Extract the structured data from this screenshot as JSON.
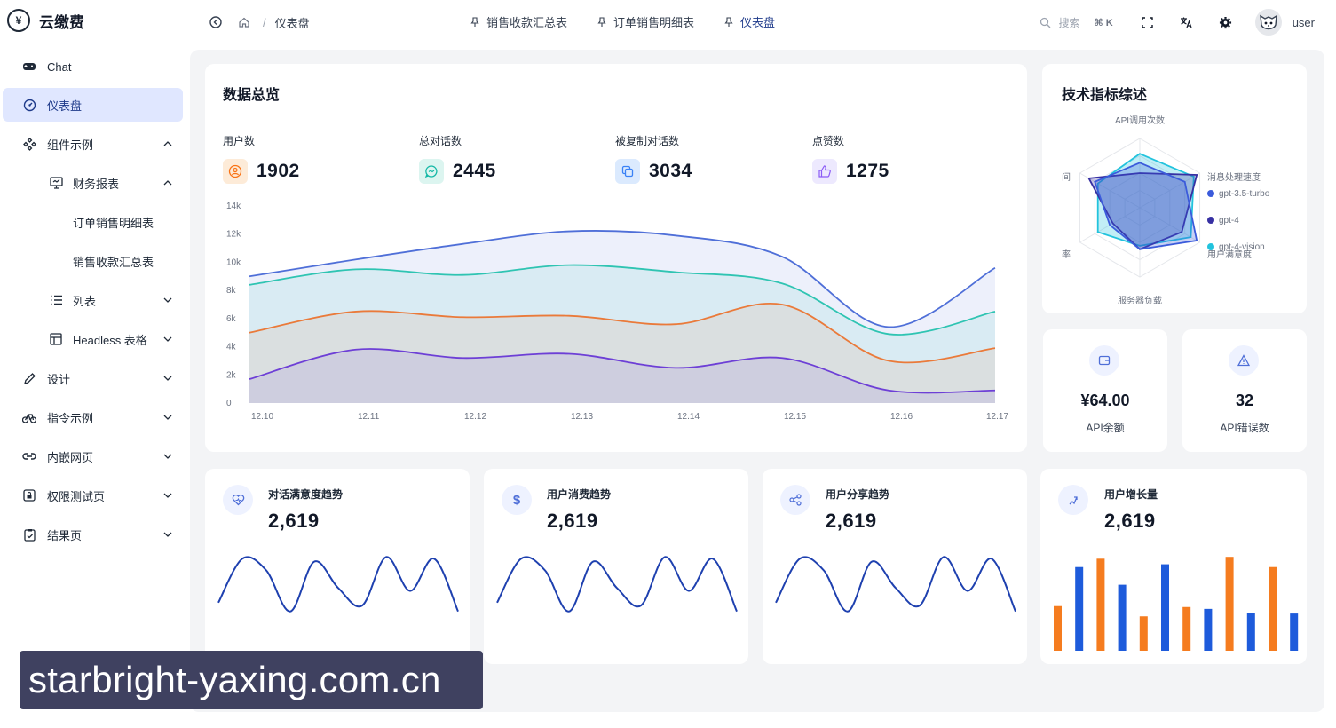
{
  "brand": {
    "name": "云缴费"
  },
  "breadcrumb": {
    "current": "仪表盘",
    "separator": "/"
  },
  "tabs": [
    {
      "label": "销售收款汇总表",
      "active": false
    },
    {
      "label": "订单销售明细表",
      "active": false
    },
    {
      "label": "仪表盘",
      "active": true
    }
  ],
  "header": {
    "search_placeholder": "搜索",
    "search_shortcut": "⌘ K",
    "username": "user"
  },
  "sidebar": {
    "items": [
      {
        "label": "Chat"
      },
      {
        "label": "仪表盘"
      },
      {
        "label": "组件示例"
      },
      {
        "label": "财务报表"
      },
      {
        "label": "订单销售明细表"
      },
      {
        "label": "销售收款汇总表"
      },
      {
        "label": "列表"
      },
      {
        "label": "Headless 表格"
      },
      {
        "label": "设计"
      },
      {
        "label": "指令示例"
      },
      {
        "label": "内嵌网页"
      },
      {
        "label": "权限测试页"
      },
      {
        "label": "结果页"
      }
    ]
  },
  "overview": {
    "title": "数据总览",
    "stats": [
      {
        "label": "用户数",
        "value": "1902",
        "color": "#f97316"
      },
      {
        "label": "总对话数",
        "value": "2445",
        "color": "#14b8a6"
      },
      {
        "label": "被复制对话数",
        "value": "3034",
        "color": "#3b82f6"
      },
      {
        "label": "点赞数",
        "value": "1275",
        "color": "#8b5cf6"
      }
    ]
  },
  "chart_data": [
    {
      "type": "area",
      "x": [
        "12.10",
        "12.11",
        "12.12",
        "12.13",
        "12.14",
        "12.15",
        "12.16",
        "12.17"
      ],
      "ylim": [
        0,
        14000
      ],
      "yticks": [
        "0",
        "2k",
        "4k",
        "6k",
        "8k",
        "10k",
        "12k",
        "14k"
      ],
      "series": [
        {
          "color": "#4f6fd8",
          "values": [
            9000,
            10200,
            11300,
            12200,
            11900,
            10400,
            5400,
            9600
          ]
        },
        {
          "color": "#2fc4b2",
          "values": [
            8400,
            9500,
            9100,
            9800,
            9300,
            8500,
            4900,
            6500
          ]
        },
        {
          "color": "#ea7a3a",
          "values": [
            5000,
            6500,
            6100,
            6200,
            5600,
            7000,
            3000,
            3900
          ]
        },
        {
          "color": "#6d3fd6",
          "values": [
            1700,
            3800,
            3200,
            3500,
            2500,
            3200,
            900,
            900
          ]
        }
      ]
    },
    {
      "type": "radar",
      "title": "API调用次数",
      "indicators": [
        "API调用次数",
        "消息处理速度",
        "用户满意度",
        "服务器负载",
        "率",
        "间"
      ],
      "legend": [
        "gpt-3.5-turbo",
        "gpt-4",
        "gpt-4-vision"
      ],
      "legend_colors": [
        "#3b5bdb",
        "#3730a3",
        "#22c3dd"
      ]
    },
    {
      "type": "line",
      "title": "对话满意度趋势",
      "values": [
        20,
        95,
        75,
        5,
        90,
        45,
        15,
        98,
        40,
        95,
        5
      ]
    },
    {
      "type": "line",
      "title": "用户消费趋势",
      "values": [
        20,
        95,
        75,
        5,
        90,
        45,
        15,
        98,
        40,
        95,
        5
      ]
    },
    {
      "type": "line",
      "title": "用户分享趋势",
      "values": [
        20,
        95,
        75,
        5,
        90,
        45,
        15,
        98,
        40,
        95,
        5
      ]
    },
    {
      "type": "bar",
      "title": "用户增长量",
      "values": [
        48,
        90,
        99,
        71,
        37,
        93,
        47,
        45,
        101,
        41,
        90,
        40
      ],
      "colors": [
        "#f57c1f",
        "#1e5bdb",
        "#f57c1f",
        "#1e5bdb",
        "#f57c1f",
        "#1e5bdb",
        "#f57c1f",
        "#1e5bdb",
        "#f57c1f",
        "#1e5bdb",
        "#f57c1f",
        "#1e5bdb"
      ]
    }
  ],
  "tech": {
    "title": "技术指标综述"
  },
  "api_balance": {
    "value": "¥64.00",
    "label": "API余额"
  },
  "api_errors": {
    "value": "32",
    "label": "API错误数"
  },
  "mini_cards": [
    {
      "title": "对话满意度趋势",
      "value": "2,619"
    },
    {
      "title": "用户消费趋势",
      "value": "2,619"
    },
    {
      "title": "用户分享趋势",
      "value": "2,619"
    },
    {
      "title": "用户增长量",
      "value": "2,619"
    }
  ],
  "watermark": {
    "text": "starbright-yaxing.com.cn"
  }
}
